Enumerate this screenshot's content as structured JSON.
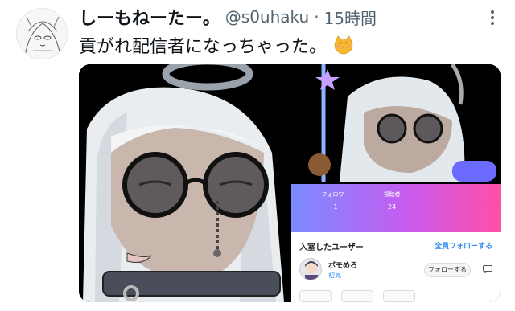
{
  "tweet": {
    "display_name": "しーもねーたー。",
    "handle": "@s0uhaku",
    "separator": "·",
    "time": "15時間",
    "text": "貢がれ配信者になっちゃった。",
    "emoji": "kissing-cat-emoji"
  },
  "app_screenshot": {
    "stats": [
      {
        "label": "フォロワー",
        "value": "1"
      },
      {
        "label": "視聴者",
        "value": "24"
      }
    ],
    "room_title": "入室したユーザー",
    "follow_all": "全員フォローする",
    "user": {
      "name": "ボモめろ",
      "badge": "初見",
      "follow_button": "フォローする"
    }
  },
  "colors": {
    "accent": "#2d8cf0",
    "secondary_text": "#536471",
    "gradient_start": "#7a8cff",
    "gradient_end": "#ff4fa8"
  }
}
